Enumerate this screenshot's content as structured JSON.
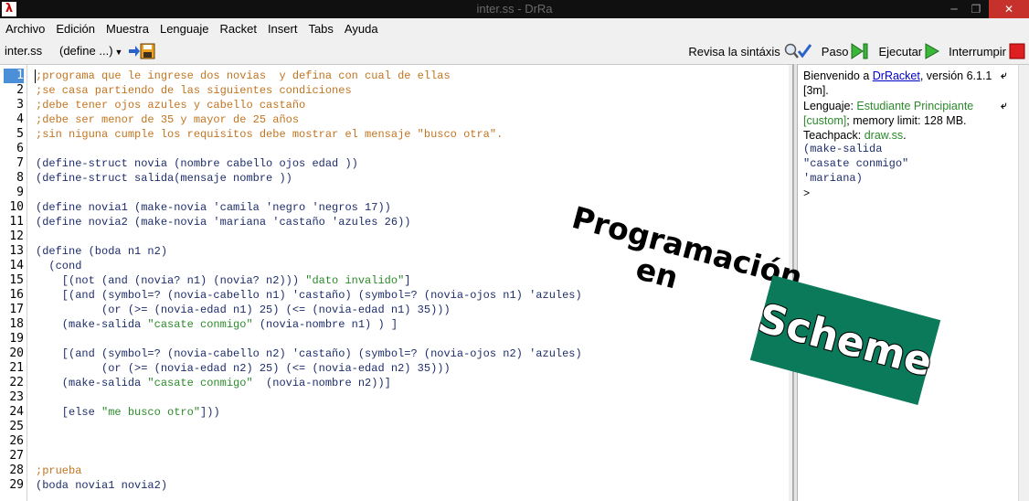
{
  "window": {
    "title": "inter.ss - DrRa",
    "min": "─",
    "max": "❐",
    "close": "✕"
  },
  "menu": [
    "Archivo",
    "Edición",
    "Muestra",
    "Lenguaje",
    "Racket",
    "Insert",
    "Tabs",
    "Ayuda"
  ],
  "toolbar": {
    "file_label": "inter.ss",
    "define_label": "(define ...)",
    "check_syntax": "Revisa la sintáxis",
    "step": "Paso",
    "run": "Ejecutar",
    "stop": "Interrumpir"
  },
  "editor": {
    "active_line": 1,
    "lines": [
      ";programa que le ingrese dos novias  y defina con cual de ellas",
      ";se casa partiendo de las siguientes condiciones",
      ";debe tener ojos azules y cabello castaño",
      ";debe ser menor de 35 y mayor de 25 años",
      ";sin niguna cumple los requisitos debe mostrar el mensaje \"busco otra\".",
      "",
      "(define-struct novia (nombre cabello ojos edad ))",
      "(define-struct salida(mensaje nombre ))",
      "",
      "(define novia1 (make-novia 'camila 'negro 'negros 17))",
      "(define novia2 (make-novia 'mariana 'castaño 'azules 26))",
      "",
      "(define (boda n1 n2)",
      "  (cond",
      "    [(not (and (novia? n1) (novia? n2))) \"dato invalido\"]",
      "    [(and (symbol=? (novia-cabello n1) 'castaño) (symbol=? (novia-ojos n1) 'azules)",
      "          (or (>= (novia-edad n1) 25) (<= (novia-edad n1) 35)))",
      "    (make-salida \"casate conmigo\" (novia-nombre n1) ) ]",
      "",
      "    [(and (symbol=? (novia-cabello n2) 'castaño) (symbol=? (novia-ojos n2) 'azules)",
      "          (or (>= (novia-edad n2) 25) (<= (novia-edad n2) 35)))",
      "    (make-salida \"casate conmigo\"  (novia-nombre n2))]",
      "",
      "    [else \"me busco otro\"]))",
      "",
      "",
      "",
      ";prueba",
      "(boda novia1 novia2)"
    ]
  },
  "repl": {
    "welcome_prefix": "Bienvenido a ",
    "welcome_link": "DrRacket",
    "welcome_version": ", versión 6.1.1",
    "welcome_build": "[3m].",
    "language_prefix": "Lenguaje: ",
    "language_name": "Estudiante Principiante",
    "language_custom": "[custom]",
    "memory": "; memory limit: 128 MB.",
    "teachpack_prefix": "Teachpack: ",
    "teachpack_name": "draw.ss",
    "teachpack_suffix": ".",
    "out1": "(make-salida",
    "out2": " \"casate conmigo\"",
    "out3": " 'mariana)",
    "prompt": ">",
    "wrap": "⤶"
  },
  "logo": {
    "line1": "Programación",
    "line2": "en",
    "line3": "Scheme"
  },
  "colors": {
    "comment": "#c2741f",
    "string": "#2b8a2b",
    "logo_green": "#0a7a5a"
  }
}
